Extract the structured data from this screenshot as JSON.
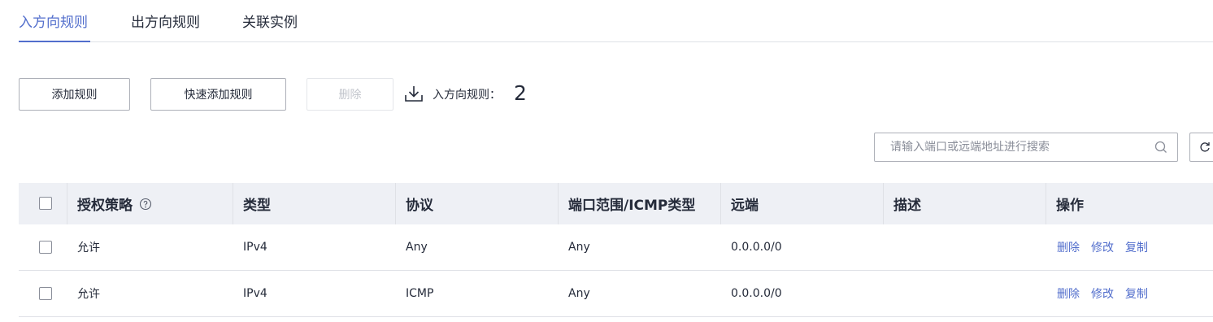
{
  "tabs": [
    {
      "label": "入方向规则",
      "active": true
    },
    {
      "label": "出方向规则",
      "active": false
    },
    {
      "label": "关联实例",
      "active": false
    }
  ],
  "toolbar": {
    "add_rule": "添加规则",
    "quick_add_rule": "快速添加规则",
    "delete": "删除",
    "download_icon": "download-icon",
    "count_label": "入方向规则：",
    "count_value": "2"
  },
  "search": {
    "placeholder": "请输入端口或远端地址进行搜索",
    "icon": "search-icon",
    "refresh_icon": "refresh-icon"
  },
  "table": {
    "headers": [
      "授权策略",
      "类型",
      "协议",
      "端口范围/ICMP类型",
      "远端",
      "描述",
      "操作"
    ],
    "rows": [
      {
        "policy": "允许",
        "type": "IPv4",
        "protocol": "Any",
        "port": "Any",
        "remote": "0.0.0.0/0",
        "desc": "",
        "ops": [
          "删除",
          "修改",
          "复制"
        ]
      },
      {
        "policy": "允许",
        "type": "IPv4",
        "protocol": "ICMP",
        "port": "Any",
        "remote": "0.0.0.0/0",
        "desc": "",
        "ops": [
          "删除",
          "修改",
          "复制"
        ]
      }
    ]
  },
  "colors": {
    "accent": "#526ecc",
    "header_bg": "#eef0f5",
    "border": "#adb0b8"
  }
}
